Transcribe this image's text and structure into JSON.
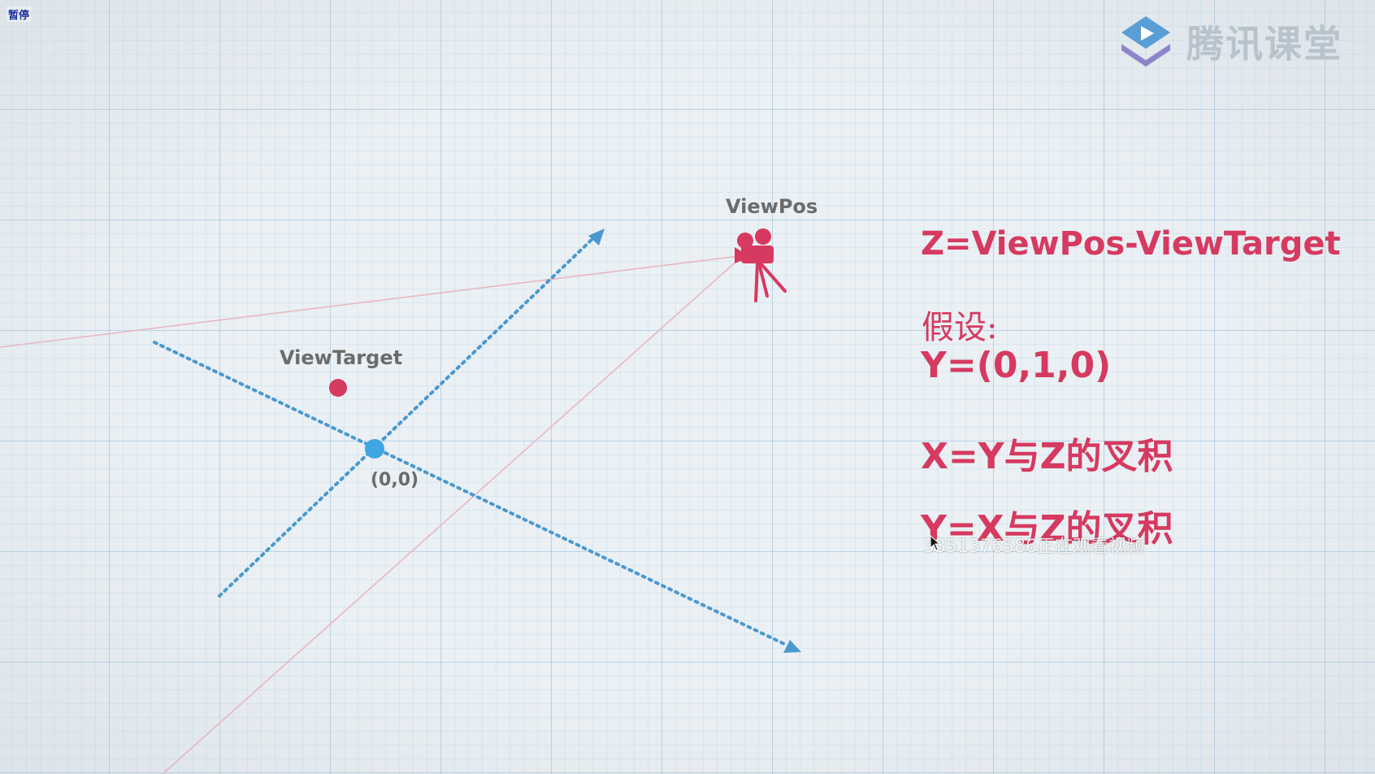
{
  "overlay": {
    "pause_label": "暂停",
    "viewer_notice": "3351376586正在观看视频"
  },
  "logo": {
    "text": "腾讯课堂",
    "icon": "play-triangle-icon"
  },
  "diagram": {
    "view_target_label": "ViewTarget",
    "view_pos_label": "ViewPos",
    "origin_label": "(0,0)",
    "camera_icon": "movie-camera-icon"
  },
  "formulas": {
    "z_def": "Z=ViewPos-ViewTarget",
    "assume": "假设:",
    "y_assume": "Y=(0,1,0)",
    "x_def": "X=Y与Z的叉积",
    "y_def": "Y=X与Z的叉积"
  },
  "colors": {
    "accent_pink": "#d63a60",
    "axis_blue": "#4a98cf",
    "origin_blue": "#3fa6e4",
    "guide_line": "#e9b6c2"
  }
}
